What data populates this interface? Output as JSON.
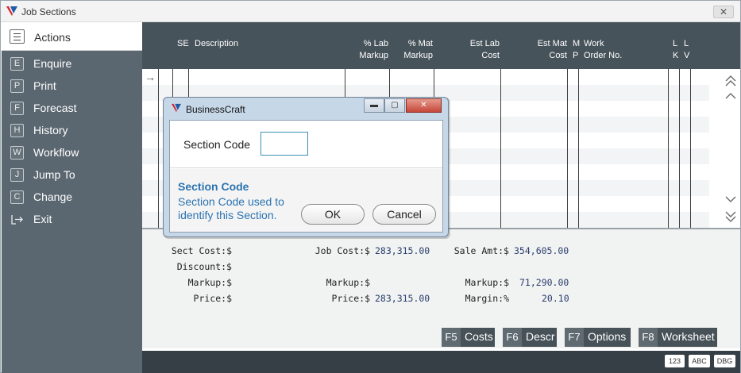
{
  "window": {
    "title": "Job Sections",
    "close_label": "✕"
  },
  "sidebar": {
    "header_label": "Actions",
    "items": [
      {
        "key": "E",
        "label": "Enquire"
      },
      {
        "key": "P",
        "label": "Print"
      },
      {
        "key": "F",
        "label": "Forecast"
      },
      {
        "key": "H",
        "label": "History"
      },
      {
        "key": "W",
        "label": "Workflow"
      },
      {
        "key": "J",
        "label": "Jump To"
      },
      {
        "key": "C",
        "label": "Change"
      },
      {
        "key": "",
        "label": "Exit"
      }
    ]
  },
  "grid": {
    "columns": {
      "se": "SE",
      "description": "Description",
      "lab_markup_1": "% Lab",
      "lab_markup_2": "Markup",
      "mat_markup_1": "% Mat",
      "mat_markup_2": "Markup",
      "est_lab_1": "Est Lab",
      "est_lab_2": "Cost",
      "est_mat_1": "Est Mat",
      "est_mat_2": "Cost",
      "mp_1": "M",
      "mp_2": "P",
      "work_order_1": "Work",
      "work_order_2": "Order No.",
      "lk_1": "L",
      "lk_2": "K",
      "lv_1": "L",
      "lv_2": "V"
    },
    "current_row_glyph": "→"
  },
  "totals": {
    "sect_cost_label": "Sect Cost:$",
    "discount_label": "Discount:$",
    "markup_label_1": "Markup:$",
    "price_label_1": "Price:$",
    "job_cost_label": "Job Cost:$",
    "job_cost_value": "283,315.00",
    "markup_label_2": "Markup:$",
    "price_label_2": "Price:$",
    "price_value_2": "283,315.00",
    "sale_amt_label": "Sale Amt:$",
    "sale_amt_value": "354,605.00",
    "markup_label_3": "Markup:$",
    "markup_value_3": "71,290.00",
    "margin_label": "Margin:%",
    "margin_value": "20.10"
  },
  "fkeys": [
    {
      "key": "F5",
      "label": "Costs"
    },
    {
      "key": "F6",
      "label": "Descr"
    },
    {
      "key": "F7",
      "label": "Options"
    },
    {
      "key": "F8",
      "label": "Worksheet"
    }
  ],
  "status_badges": [
    "123",
    "ABC",
    "DBG"
  ],
  "dialog": {
    "title": "BusinessCraft",
    "field_label": "Section Code",
    "field_value": "",
    "help_title": "Section Code",
    "help_text": "Section Code used to identify this Section.",
    "ok_label": "OK",
    "cancel_label": "Cancel",
    "min_glyph": "▬",
    "max_glyph": "▢",
    "close_glyph": "✕"
  },
  "colors": {
    "sidebar": "#5b6770",
    "grid_header": "#47535b",
    "help_text": "#2b73b1",
    "logo_red": "#d4262c",
    "logo_blue": "#1f5aa8"
  }
}
